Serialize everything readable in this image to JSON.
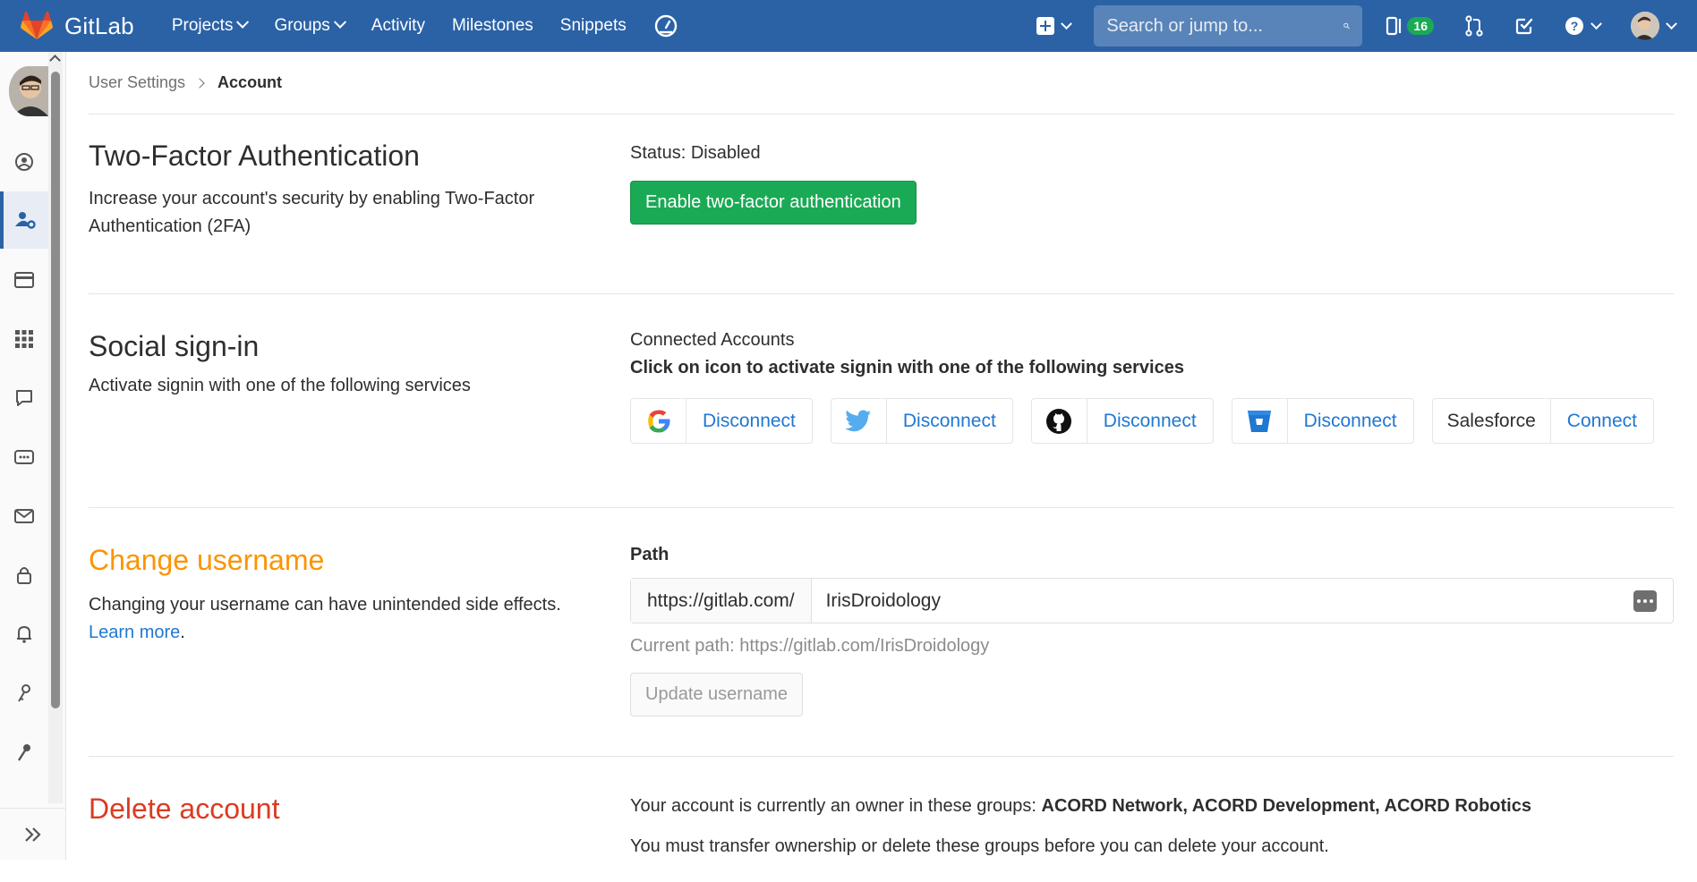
{
  "navbar": {
    "brand": "GitLab",
    "links": [
      {
        "label": "Projects",
        "dropdown": true
      },
      {
        "label": "Groups",
        "dropdown": true
      },
      {
        "label": "Activity",
        "dropdown": false
      },
      {
        "label": "Milestones",
        "dropdown": false
      },
      {
        "label": "Snippets",
        "dropdown": false
      }
    ],
    "search_placeholder": "Search or jump to...",
    "issues_count": "16"
  },
  "breadcrumb": {
    "parent": "User Settings",
    "current": "Account"
  },
  "two_factor": {
    "title": "Two-Factor Authentication",
    "description": "Increase your account's security by enabling Two-Factor Authentication (2FA)",
    "status": "Status: Disabled",
    "button": "Enable two-factor authentication"
  },
  "social": {
    "title": "Social sign-in",
    "description": "Activate signin with one of the following services",
    "connected_label": "Connected Accounts",
    "instruction": "Click on icon to activate signin with one of the following services",
    "providers": [
      {
        "name": "google",
        "action": "Disconnect"
      },
      {
        "name": "twitter",
        "action": "Disconnect"
      },
      {
        "name": "github",
        "action": "Disconnect"
      },
      {
        "name": "bitbucket",
        "action": "Disconnect"
      },
      {
        "name": "Salesforce",
        "action": "Connect"
      }
    ]
  },
  "username": {
    "title": "Change username",
    "description": "Changing your username can have unintended side effects.",
    "learn_more": "Learn more",
    "period": ".",
    "path_label": "Path",
    "prefix": "https://gitlab.com/",
    "value": "IrisDroidology",
    "current_path": "Current path: https://gitlab.com/IrisDroidology",
    "button": "Update username"
  },
  "delete": {
    "title": "Delete account",
    "owner_text": "Your account is currently an owner in these groups: ",
    "groups": "ACORD Network, ACORD Development, ACORD Robotics",
    "transfer_text": "You must transfer ownership or delete these groups before you can delete your account."
  },
  "colors": {
    "navbar": "#2b62a6",
    "success": "#1aaa55",
    "link": "#1f78d1",
    "warning": "#fc9403",
    "danger": "#db3b21"
  }
}
